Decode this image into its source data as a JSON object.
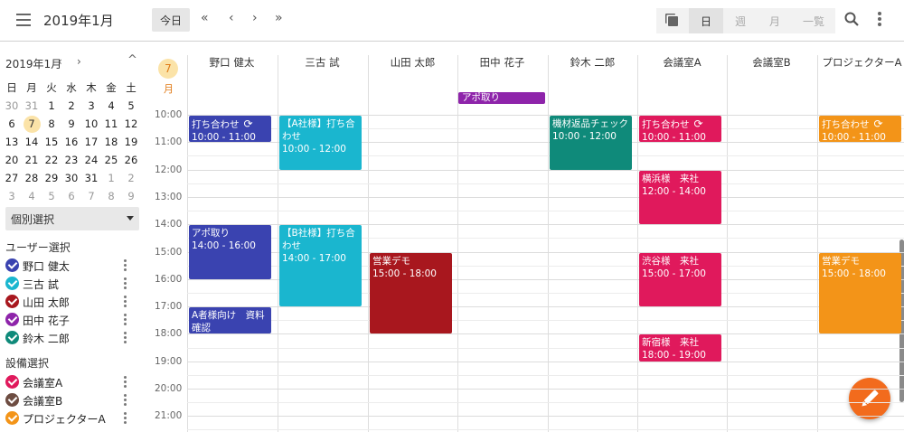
{
  "header": {
    "title": "2019年1月",
    "today_label": "今日",
    "views": [
      "日",
      "週",
      "月",
      "一覧"
    ],
    "active_view": "日"
  },
  "sidebar": {
    "mini_calendar": {
      "title": "2019年1月",
      "weekdays": [
        "日",
        "月",
        "火",
        "水",
        "木",
        "金",
        "土"
      ],
      "weeks": [
        [
          "30",
          "31",
          "1",
          "2",
          "3",
          "4",
          "5"
        ],
        [
          "6",
          "7",
          "8",
          "9",
          "10",
          "11",
          "12"
        ],
        [
          "13",
          "14",
          "15",
          "16",
          "17",
          "18",
          "19"
        ],
        [
          "20",
          "21",
          "22",
          "23",
          "24",
          "25",
          "26"
        ],
        [
          "27",
          "28",
          "29",
          "30",
          "31",
          "1",
          "2"
        ],
        [
          "3",
          "4",
          "5",
          "6",
          "7",
          "8",
          "9"
        ]
      ],
      "today": "7"
    },
    "select_label": "個別選択",
    "user_section_title": "ユーザー選択",
    "users": [
      {
        "name": "野口 健太",
        "color": "#3a43b0"
      },
      {
        "name": "三古 試",
        "color": "#1ab6cf"
      },
      {
        "name": "山田 太郎",
        "color": "#a8171e"
      },
      {
        "name": "田中 花子",
        "color": "#8e24aa"
      },
      {
        "name": "鈴木 二郎",
        "color": "#0f8a7a"
      }
    ],
    "equipment_section_title": "設備選択",
    "equipment": [
      {
        "name": "会議室A",
        "color": "#e0195c"
      },
      {
        "name": "会議室B",
        "color": "#6d4c41"
      },
      {
        "name": "プロジェクターA",
        "color": "#f39418"
      }
    ]
  },
  "calendar": {
    "date_number": "7",
    "date_month": "月",
    "columns": [
      "野口 健太",
      "三古 試",
      "山田 太郎",
      "田中 花子",
      "鈴木 二郎",
      "会議室A",
      "会議室B",
      "プロジェクターA"
    ],
    "hours": [
      "10:00",
      "11:00",
      "12:00",
      "13:00",
      "14:00",
      "15:00",
      "16:00",
      "17:00",
      "18:00",
      "19:00",
      "20:00",
      "21:00"
    ],
    "allday_events": [
      {
        "column": 3,
        "title": "アポ取り",
        "color": "#8e24aa"
      }
    ],
    "events": [
      {
        "column": 0,
        "title": "打ち合わせ",
        "time": "10:00 - 11:00",
        "start": 10,
        "end": 11,
        "color": "#3a43b0",
        "repeat": true
      },
      {
        "column": 0,
        "title": "アポ取り",
        "time": "14:00 - 16:00",
        "start": 14,
        "end": 16,
        "color": "#3a43b0",
        "repeat": false
      },
      {
        "column": 0,
        "title": "A者様向け　資料確認",
        "time": "17:00 - 18:00",
        "start": 17,
        "end": 18,
        "color": "#3a43b0",
        "repeat": false
      },
      {
        "column": 1,
        "title": "【A社様】打ち合わせ",
        "time": "10:00 - 12:00",
        "start": 10,
        "end": 12,
        "color": "#1ab6cf",
        "repeat": false
      },
      {
        "column": 1,
        "title": "【B社様】打ち合わせ",
        "time": "14:00 - 17:00",
        "start": 14,
        "end": 17,
        "color": "#1ab6cf",
        "repeat": false
      },
      {
        "column": 2,
        "title": "営業デモ",
        "time": "15:00 - 18:00",
        "start": 15,
        "end": 18,
        "color": "#a8171e",
        "repeat": false
      },
      {
        "column": 4,
        "title": "機材返品チェック",
        "time": "10:00 - 12:00",
        "start": 10,
        "end": 12,
        "color": "#0f8a7a",
        "repeat": false
      },
      {
        "column": 5,
        "title": "打ち合わせ",
        "time": "10:00 - 11:00",
        "start": 10,
        "end": 11,
        "color": "#e0195c",
        "repeat": true
      },
      {
        "column": 5,
        "title": "横浜様　来社",
        "time": "12:00 - 14:00",
        "start": 12,
        "end": 14,
        "color": "#e0195c",
        "repeat": false
      },
      {
        "column": 5,
        "title": "渋谷様　来社",
        "time": "15:00 - 17:00",
        "start": 15,
        "end": 17,
        "color": "#e0195c",
        "repeat": false
      },
      {
        "column": 5,
        "title": "新宿様　来社",
        "time": "18:00 - 19:00",
        "start": 18,
        "end": 19,
        "color": "#e0195c",
        "repeat": false
      },
      {
        "column": 7,
        "title": "打ち合わせ",
        "time": "10:00 - 11:00",
        "start": 10,
        "end": 11,
        "color": "#f39418",
        "repeat": true
      },
      {
        "column": 7,
        "title": "営業デモ",
        "time": "15:00 - 18:00",
        "start": 15,
        "end": 18,
        "color": "#f39418",
        "repeat": false
      }
    ]
  }
}
